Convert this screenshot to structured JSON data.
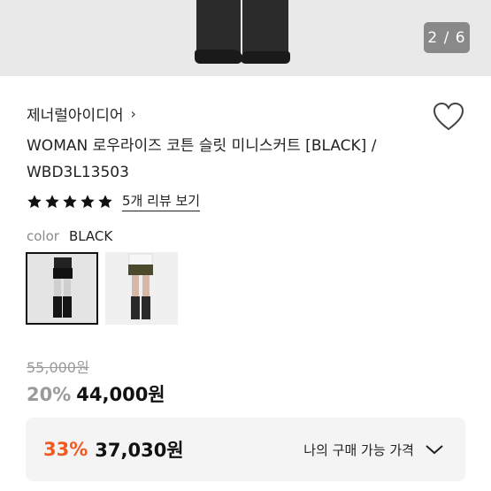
{
  "gallery": {
    "counter": "2 / 6"
  },
  "product": {
    "brand": "제너럴아이디어",
    "title_line1": "WOMAN 로우라이즈 코튼 슬릿 미니스커트 [BLACK] /",
    "title_line2": "WBD3L13503",
    "rating_stars": 5,
    "review_link": "5개 리뷰 보기"
  },
  "color": {
    "label": "color",
    "value": "BLACK"
  },
  "price": {
    "original": "55,000원",
    "discount": "20%",
    "sale": "44,000원"
  },
  "my_price": {
    "discount": "33%",
    "price": "37,030원",
    "label": "나의 구매 가능 가격"
  },
  "colors": {
    "accent": "#f05a22",
    "text": "#222222",
    "muted": "#9a9a9a",
    "box": "#f4f4f4"
  }
}
